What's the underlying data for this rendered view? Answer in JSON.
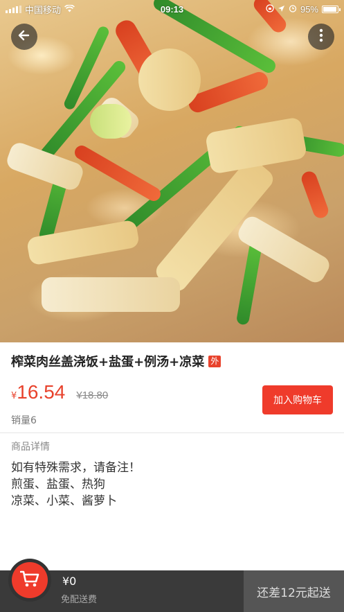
{
  "status_bar": {
    "carrier": "中国移动",
    "time": "09:13",
    "battery": "95%",
    "battery_level": 0.95
  },
  "product": {
    "title": "榨菜肉丝盖浇饭+盐蛋+例汤+凉菜",
    "badge": "外",
    "currency": "¥",
    "price": "16.54",
    "original_price": "¥18.80",
    "sales": "销量6",
    "add_to_cart": "加入购物车"
  },
  "detail": {
    "label": "商品详情",
    "lines": [
      "如有特殊需求，请备注！",
      "煎蛋、盐蛋、热狗",
      "凉菜、小菜、酱萝卜"
    ]
  },
  "cart_bar": {
    "total": "¥0",
    "delivery": "免配送费",
    "checkout": "还差12元起送"
  },
  "colors": {
    "accent": "#ef3b2b",
    "bottom_bar": "#3a3a3a",
    "checkout_bg": "#555555"
  },
  "icons": {
    "back": "back-arrow-icon",
    "more": "more-vertical-icon",
    "cart": "cart-icon",
    "wifi": "wifi-icon",
    "location": "location-icon",
    "alarm": "alarm-icon",
    "lock": "orientation-lock-icon"
  }
}
